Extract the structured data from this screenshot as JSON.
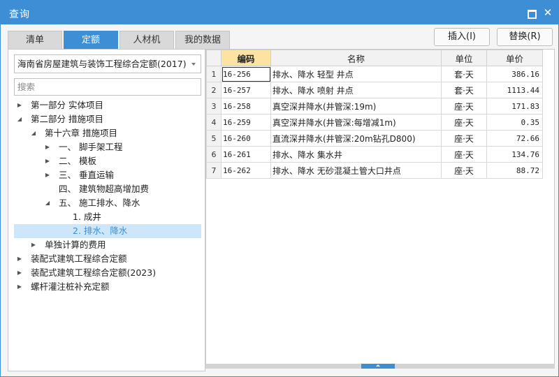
{
  "window": {
    "title": "查询"
  },
  "tabs": [
    {
      "label": "清单"
    },
    {
      "label": "定额"
    },
    {
      "label": "人材机"
    },
    {
      "label": "我的数据"
    }
  ],
  "actions": {
    "insert_label": "插入(I)",
    "replace_label": "替换(R)"
  },
  "left": {
    "dropdown_value": "海南省房屋建筑与装饰工程综合定额(2017)",
    "search_placeholder": "搜索",
    "tree": [
      {
        "label": "第一部分 实体项目",
        "state": "collapsed"
      },
      {
        "label": "第二部分 措施项目",
        "state": "expanded"
      },
      {
        "label": "第十六章 措施项目",
        "state": "expanded"
      },
      {
        "label": "一、 脚手架工程",
        "state": "collapsed"
      },
      {
        "label": "二、 模板",
        "state": "collapsed"
      },
      {
        "label": "三、 垂直运输",
        "state": "collapsed"
      },
      {
        "label": "四、 建筑物超高增加费",
        "state": "leaf"
      },
      {
        "label": "五、 施工排水、降水",
        "state": "expanded"
      },
      {
        "label": "1. 成井",
        "state": "leaf"
      },
      {
        "label": "2. 排水、降水",
        "state": "leaf",
        "selected": true
      },
      {
        "label": "单独计算的费用",
        "state": "collapsed"
      },
      {
        "label": "装配式建筑工程综合定额",
        "state": "collapsed"
      },
      {
        "label": "装配式建筑工程综合定额(2023)",
        "state": "collapsed"
      },
      {
        "label": "螺杆灌注桩补充定额",
        "state": "collapsed"
      }
    ]
  },
  "grid": {
    "headers": {
      "code": "编码",
      "name": "名称",
      "unit": "单位",
      "price": "单价"
    },
    "rows": [
      {
        "idx": "1",
        "code": "16-256",
        "name": "排水、降水 轻型 井点",
        "unit": "套·天",
        "price": "386.16"
      },
      {
        "idx": "2",
        "code": "16-257",
        "name": "排水、降水 喷射 井点",
        "unit": "套·天",
        "price": "1113.44"
      },
      {
        "idx": "3",
        "code": "16-258",
        "name": "真空深井降水(井管深:19m)",
        "unit": "座·天",
        "price": "171.83"
      },
      {
        "idx": "4",
        "code": "16-259",
        "name": "真空深井降水(井管深:每增减1m)",
        "unit": "座·天",
        "price": "0.35"
      },
      {
        "idx": "5",
        "code": "16-260",
        "name": "直流深井降水(井管深:20m钻孔D800)",
        "unit": "座·天",
        "price": "72.66"
      },
      {
        "idx": "6",
        "code": "16-261",
        "name": "排水、降水 集水井",
        "unit": "座·天",
        "price": "134.76"
      },
      {
        "idx": "7",
        "code": "16-262",
        "name": "排水、降水 无砂混凝土管大口井点",
        "unit": "座·天",
        "price": "88.72"
      }
    ]
  },
  "colors": {
    "accent": "#3d8ed4",
    "selected_bg": "#cde6f9",
    "sorted_header": "#fbe3a3"
  }
}
